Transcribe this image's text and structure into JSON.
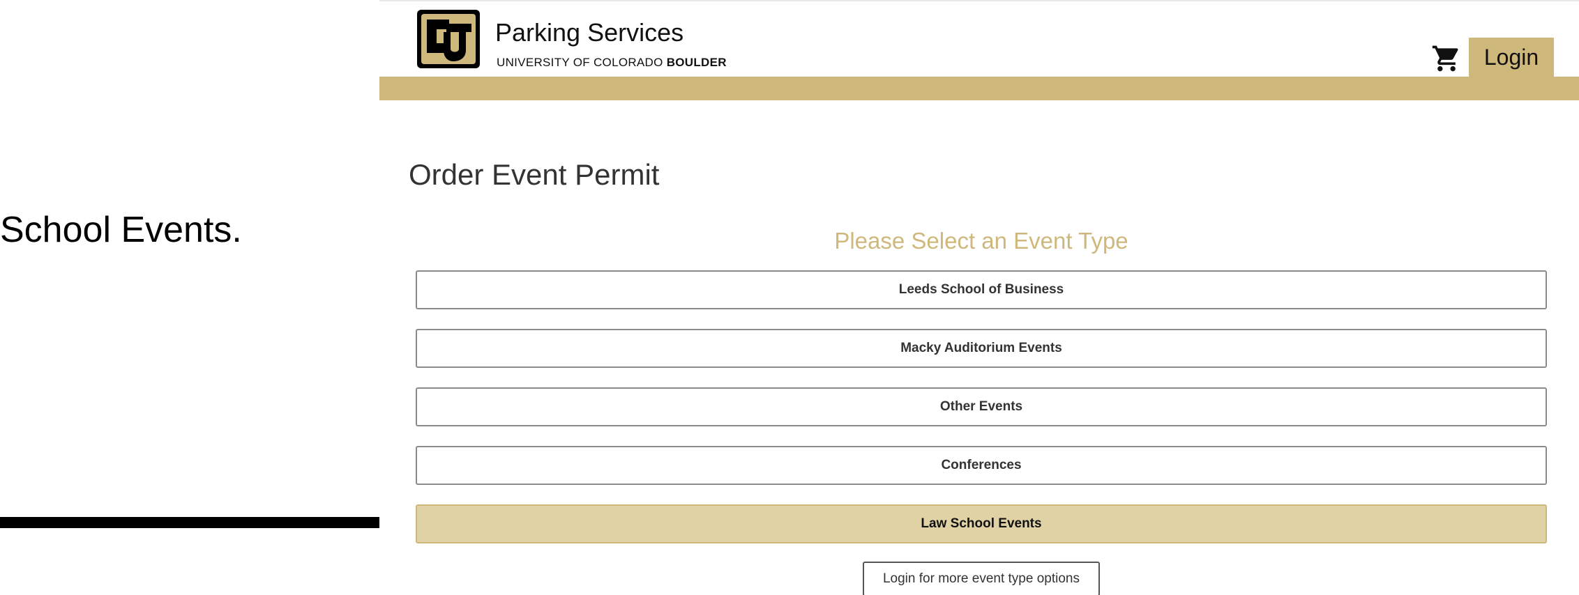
{
  "annotation": {
    "caption": "School Events."
  },
  "header": {
    "brand_title": "Parking Services",
    "brand_sub_regular": "UNIVERSITY OF COLORADO ",
    "brand_sub_bold": "BOULDER",
    "login_label": "Login"
  },
  "main": {
    "page_title": "Order Event Permit",
    "section_heading": "Please Select an Event Type",
    "event_types": [
      {
        "label": "Leeds School of Business",
        "selected": false
      },
      {
        "label": "Macky Auditorium Events",
        "selected": false
      },
      {
        "label": "Other Events",
        "selected": false
      },
      {
        "label": "Conferences",
        "selected": false
      },
      {
        "label": "Law School Events",
        "selected": true
      }
    ],
    "more_options_label": "Login for more event type options"
  },
  "colors": {
    "brand_gold": "#cfb87c",
    "selected_fill": "#e1d2a6"
  },
  "icons": {
    "cart": "shopping-cart-icon",
    "logo": "cu-logo-icon",
    "arrow": "arrow-right-icon"
  }
}
